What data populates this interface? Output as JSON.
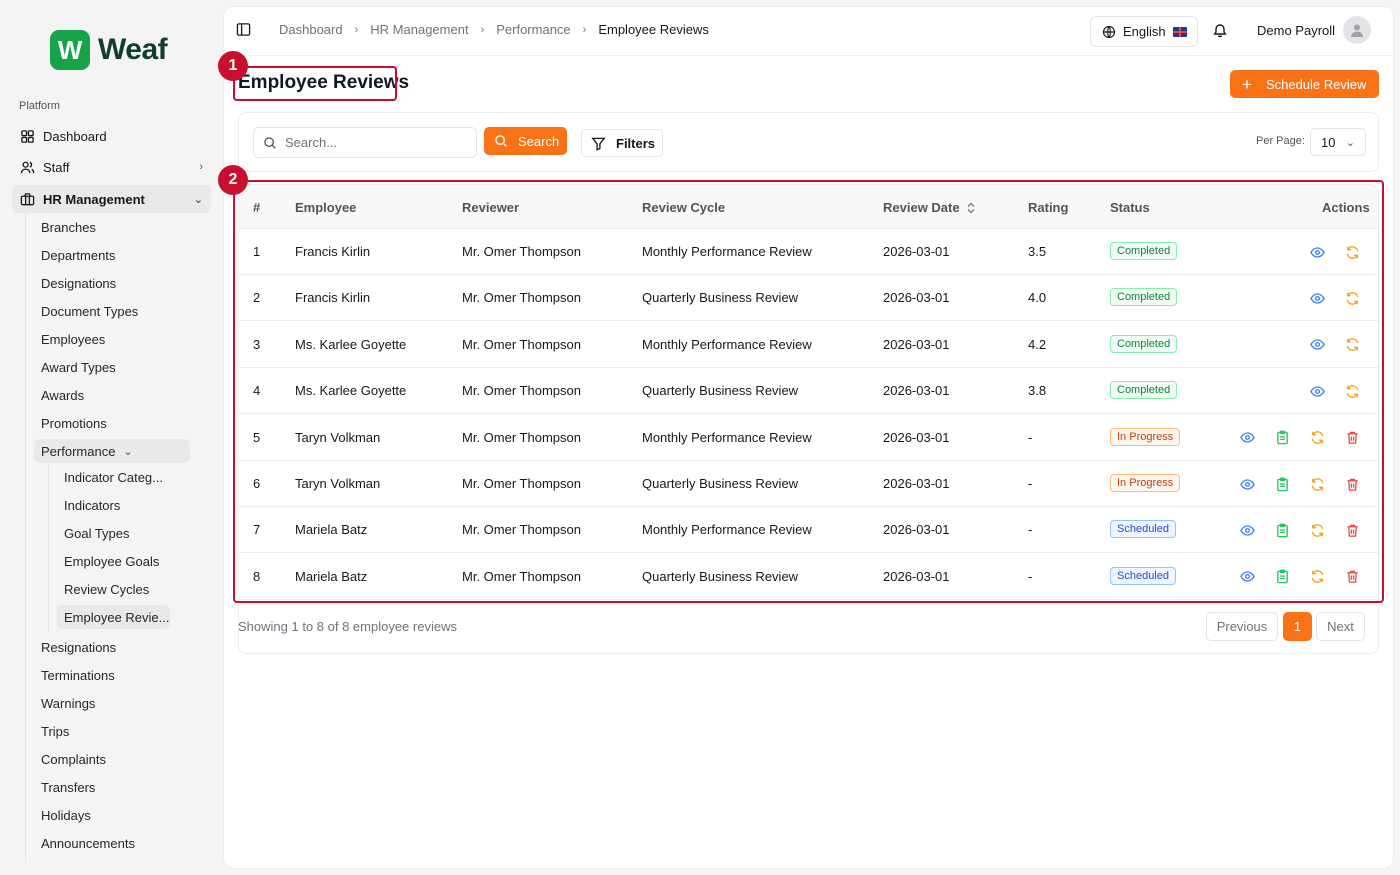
{
  "brand": {
    "logo_letter": "W",
    "name": "Weaf",
    "color": "#16a34a"
  },
  "sidebar": {
    "group_label": "Platform",
    "items": [
      {
        "label": "Dashboard",
        "icon": "grid-icon"
      },
      {
        "label": "Staff",
        "icon": "users-icon"
      },
      {
        "label": "HR Management",
        "icon": "briefcase-icon"
      }
    ],
    "hr_sub": [
      "Branches",
      "Departments",
      "Designations",
      "Document Types",
      "Employees",
      "Award Types",
      "Awards",
      "Promotions",
      "Performance"
    ],
    "performance_sub": [
      "Indicator Categ...",
      "Indicators",
      "Goal Types",
      "Employee Goals",
      "Review Cycles",
      "Employee Revie..."
    ],
    "hr_sub_after": [
      "Resignations",
      "Terminations",
      "Warnings",
      "Trips",
      "Complaints",
      "Transfers",
      "Holidays",
      "Announcements"
    ]
  },
  "header": {
    "breadcrumbs": [
      "Dashboard",
      "HR Management",
      "Performance",
      "Employee Reviews"
    ],
    "language": "English",
    "user_name": "Demo Payroll"
  },
  "page": {
    "title": "Employee Reviews",
    "primary_action": "Schedule Review",
    "accent": "#f97316"
  },
  "filters": {
    "search_placeholder": "Search...",
    "search_button": "Search",
    "filters_button": "Filters",
    "per_page_label": "Per Page:",
    "per_page_value": "10"
  },
  "table": {
    "columns": [
      "#",
      "Employee",
      "Reviewer",
      "Review Cycle",
      "Review Date",
      "Rating",
      "Status",
      "Actions"
    ],
    "rows": [
      {
        "num": "1",
        "employee": "Francis Kirlin",
        "reviewer": "Mr. Omer Thompson",
        "cycle": "Monthly Performance Review",
        "date": "2026-03-01",
        "rating": "3.5",
        "status": "Completed"
      },
      {
        "num": "2",
        "employee": "Francis Kirlin",
        "reviewer": "Mr. Omer Thompson",
        "cycle": "Quarterly Business Review",
        "date": "2026-03-01",
        "rating": "4.0",
        "status": "Completed"
      },
      {
        "num": "3",
        "employee": "Ms. Karlee Goyette",
        "reviewer": "Mr. Omer Thompson",
        "cycle": "Monthly Performance Review",
        "date": "2026-03-01",
        "rating": "4.2",
        "status": "Completed"
      },
      {
        "num": "4",
        "employee": "Ms. Karlee Goyette",
        "reviewer": "Mr. Omer Thompson",
        "cycle": "Quarterly Business Review",
        "date": "2026-03-01",
        "rating": "3.8",
        "status": "Completed"
      },
      {
        "num": "5",
        "employee": "Taryn Volkman",
        "reviewer": "Mr. Omer Thompson",
        "cycle": "Monthly Performance Review",
        "date": "2026-03-01",
        "rating": "-",
        "status": "In Progress"
      },
      {
        "num": "6",
        "employee": "Taryn Volkman",
        "reviewer": "Mr. Omer Thompson",
        "cycle": "Quarterly Business Review",
        "date": "2026-03-01",
        "rating": "-",
        "status": "In Progress"
      },
      {
        "num": "7",
        "employee": "Mariela Batz",
        "reviewer": "Mr. Omer Thompson",
        "cycle": "Monthly Performance Review",
        "date": "2026-03-01",
        "rating": "-",
        "status": "Scheduled"
      },
      {
        "num": "8",
        "employee": "Mariela Batz",
        "reviewer": "Mr. Omer Thompson",
        "cycle": "Quarterly Business Review",
        "date": "2026-03-01",
        "rating": "-",
        "status": "Scheduled"
      }
    ]
  },
  "footer": {
    "showing": "Showing 1 to 8 of 8 employee reviews",
    "previous": "Previous",
    "current_page": "1",
    "next": "Next"
  },
  "callouts": [
    "1",
    "2"
  ]
}
